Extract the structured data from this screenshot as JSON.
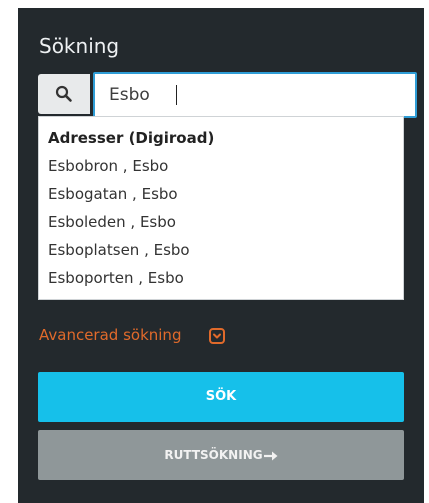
{
  "panel": {
    "title": "Sökning"
  },
  "search": {
    "value": "Esbo",
    "icon": "search-icon"
  },
  "suggestions": {
    "header": "Adresser (Digiroad)",
    "items": [
      "Esbobron , Esbo",
      "Esbogatan , Esbo",
      "Esboleden , Esbo",
      "Esboplatsen , Esbo",
      "Esboporten , Esbo"
    ]
  },
  "advanced": {
    "label": "Avancerad sökning",
    "icon": "chevron-down-box-icon",
    "color": "#e06a2b"
  },
  "buttons": {
    "search_label": "SÖK",
    "search_color": "#16c0ea",
    "route_label": "RUTTSÖKNING",
    "route_icon": "arrow-right-icon",
    "route_color": "#8f9799"
  }
}
